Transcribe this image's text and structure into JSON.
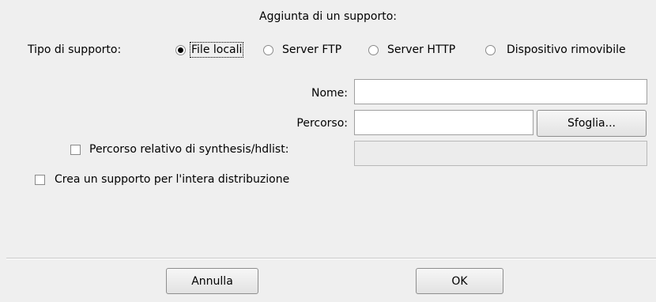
{
  "dialog": {
    "title": "Aggiunta di un supporto:"
  },
  "type": {
    "label": "Tipo di supporto:",
    "options": [
      {
        "label": "File locali",
        "selected": true
      },
      {
        "label": "Server FTP",
        "selected": false
      },
      {
        "label": "Server HTTP",
        "selected": false
      },
      {
        "label": "Dispositivo rimovibile",
        "selected": false
      }
    ]
  },
  "form": {
    "name_label": "Nome:",
    "name_value": "",
    "path_label": "Percorso:",
    "path_value": "",
    "browse_label": "Sfoglia...",
    "relative_label": "Percorso relativo di synthesis/hdlist:",
    "relative_checked": false,
    "relative_value": "",
    "distribution_label": "Crea un supporto per l'intera distribuzione",
    "distribution_checked": false
  },
  "buttons": {
    "cancel_label": "Annulla",
    "ok_label": "OK"
  }
}
